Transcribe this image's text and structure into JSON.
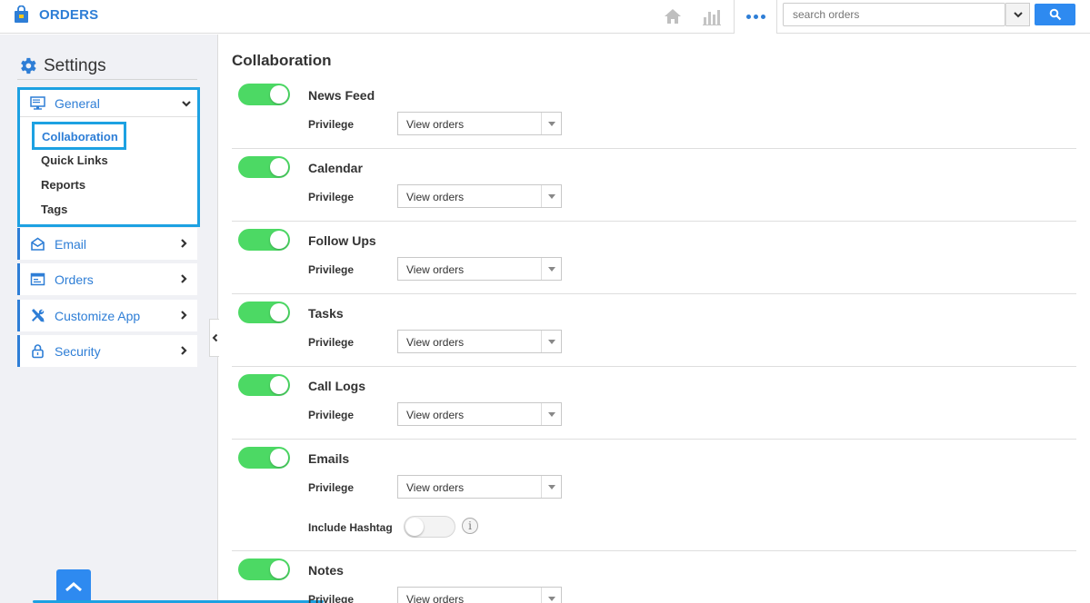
{
  "app": {
    "title": "ORDERS",
    "brand_color": "#2e7ed6",
    "accent_highlight": "#1da1e2",
    "toggle_on_color": "#4cd964"
  },
  "topbar": {
    "icons": [
      "home-icon",
      "bar-chart-icon",
      "more-dots-icon"
    ],
    "search": {
      "placeholder": "search orders",
      "value": ""
    }
  },
  "sidebar": {
    "title": "Settings",
    "general": {
      "label": "General",
      "expanded": true,
      "items": [
        {
          "label": "Collaboration",
          "active": true
        },
        {
          "label": "Quick Links"
        },
        {
          "label": "Reports"
        },
        {
          "label": "Tags"
        }
      ]
    },
    "items": [
      {
        "label": "Email",
        "icon": "email-icon"
      },
      {
        "label": "Orders",
        "icon": "orders-icon"
      },
      {
        "label": "Customize App",
        "icon": "tools-icon"
      },
      {
        "label": "Security",
        "icon": "lock-icon"
      }
    ]
  },
  "main": {
    "title": "Collaboration",
    "privilege_label": "Privilege",
    "features": [
      {
        "name": "News Feed",
        "enabled": true,
        "privilege": "View orders"
      },
      {
        "name": "Calendar",
        "enabled": true,
        "privilege": "View orders"
      },
      {
        "name": "Follow Ups",
        "enabled": true,
        "privilege": "View orders"
      },
      {
        "name": "Tasks",
        "enabled": true,
        "privilege": "View orders"
      },
      {
        "name": "Call Logs",
        "enabled": true,
        "privilege": "View orders"
      },
      {
        "name": "Emails",
        "enabled": true,
        "privilege": "View orders",
        "include_hashtag": {
          "label": "Include Hashtag",
          "enabled": false,
          "info": "i"
        }
      },
      {
        "name": "Notes",
        "enabled": true,
        "privilege": "View orders"
      }
    ]
  }
}
